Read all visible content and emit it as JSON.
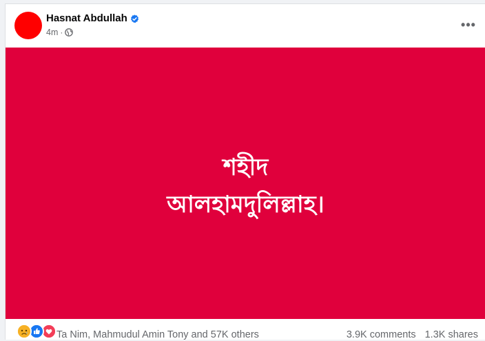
{
  "post": {
    "author": "Hasnat Abdullah",
    "verified_icon": "verified-badge-icon",
    "time": "4m",
    "separator": "·",
    "privacy_icon": "globe-icon",
    "more_icon": "more-options-icon",
    "more_label": "•••"
  },
  "image": {
    "line1": "শহীদ",
    "line2": "আলহামদুলিল্লাহ।",
    "background_color": "#e0003c"
  },
  "footer": {
    "reactions": [
      "sad-icon",
      "like-icon",
      "love-icon"
    ],
    "reactors_text": "Ta Nim, Mahmudul Amin Tony and 57K others",
    "comments": "3.9K comments",
    "shares": "1.3K shares"
  },
  "colors": {
    "avatar": "#ff0000",
    "verified": "#1877f2",
    "secondary_text": "#65676b"
  }
}
